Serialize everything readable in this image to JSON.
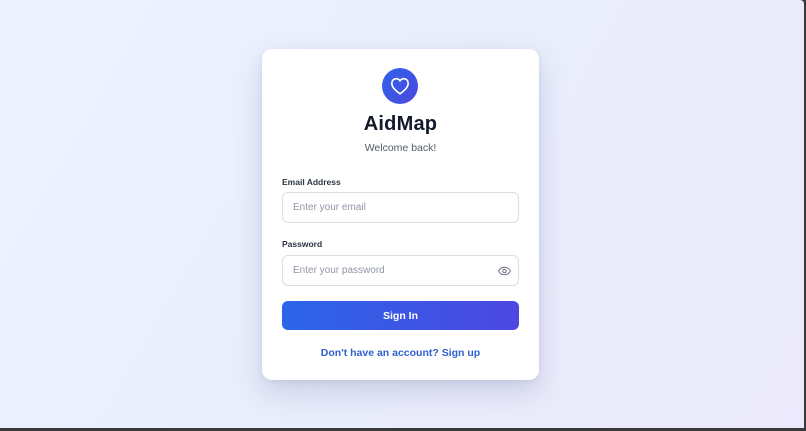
{
  "app": {
    "name": "AidMap",
    "subtitle": "Welcome back!",
    "logo_icon": "heart-icon"
  },
  "form": {
    "email": {
      "label": "Email Address",
      "placeholder": "Enter your email",
      "value": ""
    },
    "password": {
      "label": "Password",
      "placeholder": "Enter your password",
      "value": "",
      "toggle_icon": "eye-icon"
    },
    "submit_label": "Sign In",
    "signup_link": "Don't have an account? Sign up"
  },
  "colors": {
    "accent": "#2f63e6",
    "accent_end": "#4d47e1",
    "link": "#2f5fd0",
    "title": "#131a2b"
  }
}
